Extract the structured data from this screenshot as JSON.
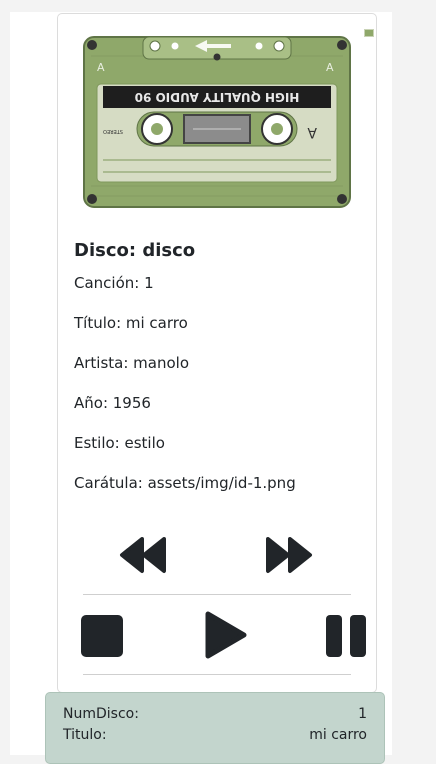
{
  "card": {
    "image_alt": "cassette",
    "cassette_label": "HIGH QUALITY AUDIO 90",
    "side": "A",
    "stereo": "STEREO",
    "heading": "Disco: disco",
    "fields": [
      "Canción: 1",
      "Título: mi carro",
      "Artista: manolo",
      "Año: 1956",
      "Estilo: estilo",
      "Carátula: assets/img/id-1.png"
    ]
  },
  "controls": {
    "rewind": "rewind-icon",
    "fast_forward": "fast-forward-icon",
    "stop": "stop-icon",
    "play": "play-icon",
    "pause": "pause-icon"
  },
  "panel": {
    "rows": [
      {
        "label": "NumDisco:",
        "value": "1"
      },
      {
        "label": "Titulo:",
        "value": "mi carro"
      }
    ]
  },
  "colors": {
    "cassette_green": "#8fa86a",
    "panel_bg": "#c3d5cd",
    "icon": "#212529"
  }
}
